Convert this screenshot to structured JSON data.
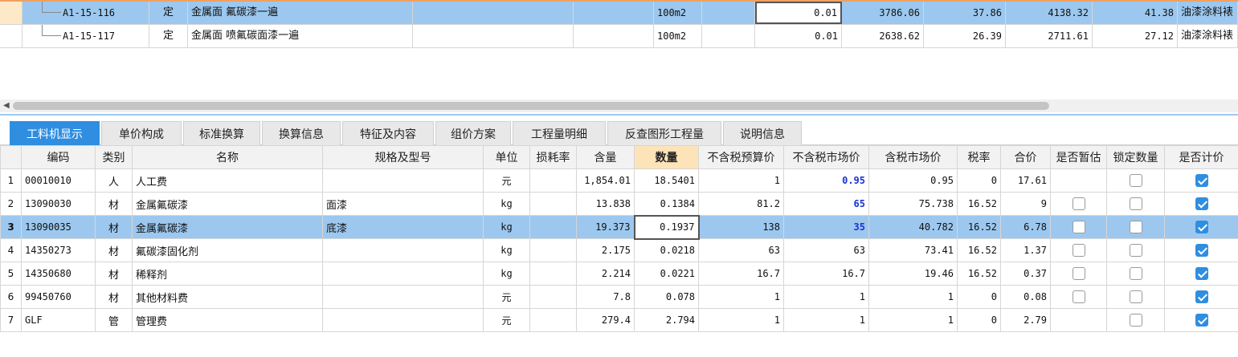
{
  "top_rows": [
    {
      "code": "A1-15-116",
      "type": "定",
      "name": "金属面 氟碳漆一遍",
      "unit": "100m2",
      "quantity": "0.01",
      "v1": "3786.06",
      "v2": "37.86",
      "v3": "4138.32",
      "v4": "41.38",
      "major": "油漆涂料裱",
      "selected": true
    },
    {
      "code": "A1-15-117",
      "type": "定",
      "name": "金属面 喷氟碳面漆一遍",
      "unit": "100m2",
      "quantity": "0.01",
      "v1": "2638.62",
      "v2": "26.39",
      "v3": "2711.61",
      "v4": "27.12",
      "major": "油漆涂料裱",
      "selected": false
    }
  ],
  "tabs": [
    "工料机显示",
    "单价构成",
    "标准换算",
    "换算信息",
    "特征及内容",
    "组价方案",
    "工程量明细",
    "反查图形工程量",
    "说明信息"
  ],
  "active_tab": 0,
  "columns": [
    "编码",
    "类别",
    "名称",
    "规格及型号",
    "单位",
    "损耗率",
    "含量",
    "数量",
    "不含税预算价",
    "不含税市场价",
    "含税市场价",
    "税率",
    "合价",
    "是否暂估",
    "锁定数量",
    "是否计价"
  ],
  "highlight_column": 7,
  "rows": [
    {
      "no": "1",
      "code": "00010010",
      "cat": "人",
      "name": "人工费",
      "spec": "",
      "unit": "元",
      "loss": "",
      "content": "1,854.01",
      "qty": "18.5401",
      "pre_tax_budget": "1",
      "pre_tax_market": "0.95",
      "tax_market": "0.95",
      "tax_rate": "0",
      "total": "17.61",
      "provisional": null,
      "locked": false,
      "priced": true,
      "selected": false
    },
    {
      "no": "2",
      "code": "13090030",
      "cat": "材",
      "name": "金属氟碳漆",
      "spec": "面漆",
      "unit": "kg",
      "loss": "",
      "content": "13.838",
      "qty": "0.1384",
      "pre_tax_budget": "81.2",
      "pre_tax_market": "65",
      "tax_market": "75.738",
      "tax_rate": "16.52",
      "total": "9",
      "provisional": false,
      "locked": false,
      "priced": true,
      "selected": false
    },
    {
      "no": "3",
      "code": "13090035",
      "cat": "材",
      "name": "金属氟碳漆",
      "spec": "底漆",
      "unit": "kg",
      "loss": "",
      "content": "19.373",
      "qty": "0.1937",
      "pre_tax_budget": "138",
      "pre_tax_market": "35",
      "tax_market": "40.782",
      "tax_rate": "16.52",
      "total": "6.78",
      "provisional": false,
      "locked": false,
      "priced": true,
      "selected": true
    },
    {
      "no": "4",
      "code": "14350273",
      "cat": "材",
      "name": "氟碳漆固化剂",
      "spec": "",
      "unit": "kg",
      "loss": "",
      "content": "2.175",
      "qty": "0.0218",
      "pre_tax_budget": "63",
      "pre_tax_market": "63",
      "tax_market": "73.41",
      "tax_rate": "16.52",
      "total": "1.37",
      "provisional": false,
      "locked": false,
      "priced": true,
      "selected": false
    },
    {
      "no": "5",
      "code": "14350680",
      "cat": "材",
      "name": "稀释剂",
      "spec": "",
      "unit": "kg",
      "loss": "",
      "content": "2.214",
      "qty": "0.0221",
      "pre_tax_budget": "16.7",
      "pre_tax_market": "16.7",
      "tax_market": "19.46",
      "tax_rate": "16.52",
      "total": "0.37",
      "provisional": false,
      "locked": false,
      "priced": true,
      "selected": false
    },
    {
      "no": "6",
      "code": "99450760",
      "cat": "材",
      "name": "其他材料费",
      "spec": "",
      "unit": "元",
      "loss": "",
      "content": "7.8",
      "qty": "0.078",
      "pre_tax_budget": "1",
      "pre_tax_market": "1",
      "tax_market": "1",
      "tax_rate": "0",
      "total": "0.08",
      "provisional": false,
      "locked": false,
      "priced": true,
      "selected": false
    },
    {
      "no": "7",
      "code": "GLF",
      "cat": "管",
      "name": "管理费",
      "spec": "",
      "unit": "元",
      "loss": "",
      "content": "279.4",
      "qty": "2.794",
      "pre_tax_budget": "1",
      "pre_tax_market": "1",
      "tax_market": "1",
      "tax_rate": "0",
      "total": "2.79",
      "provisional": null,
      "locked": false,
      "priced": true,
      "selected": false
    }
  ],
  "blue_market_rows": [
    0,
    1,
    2
  ]
}
